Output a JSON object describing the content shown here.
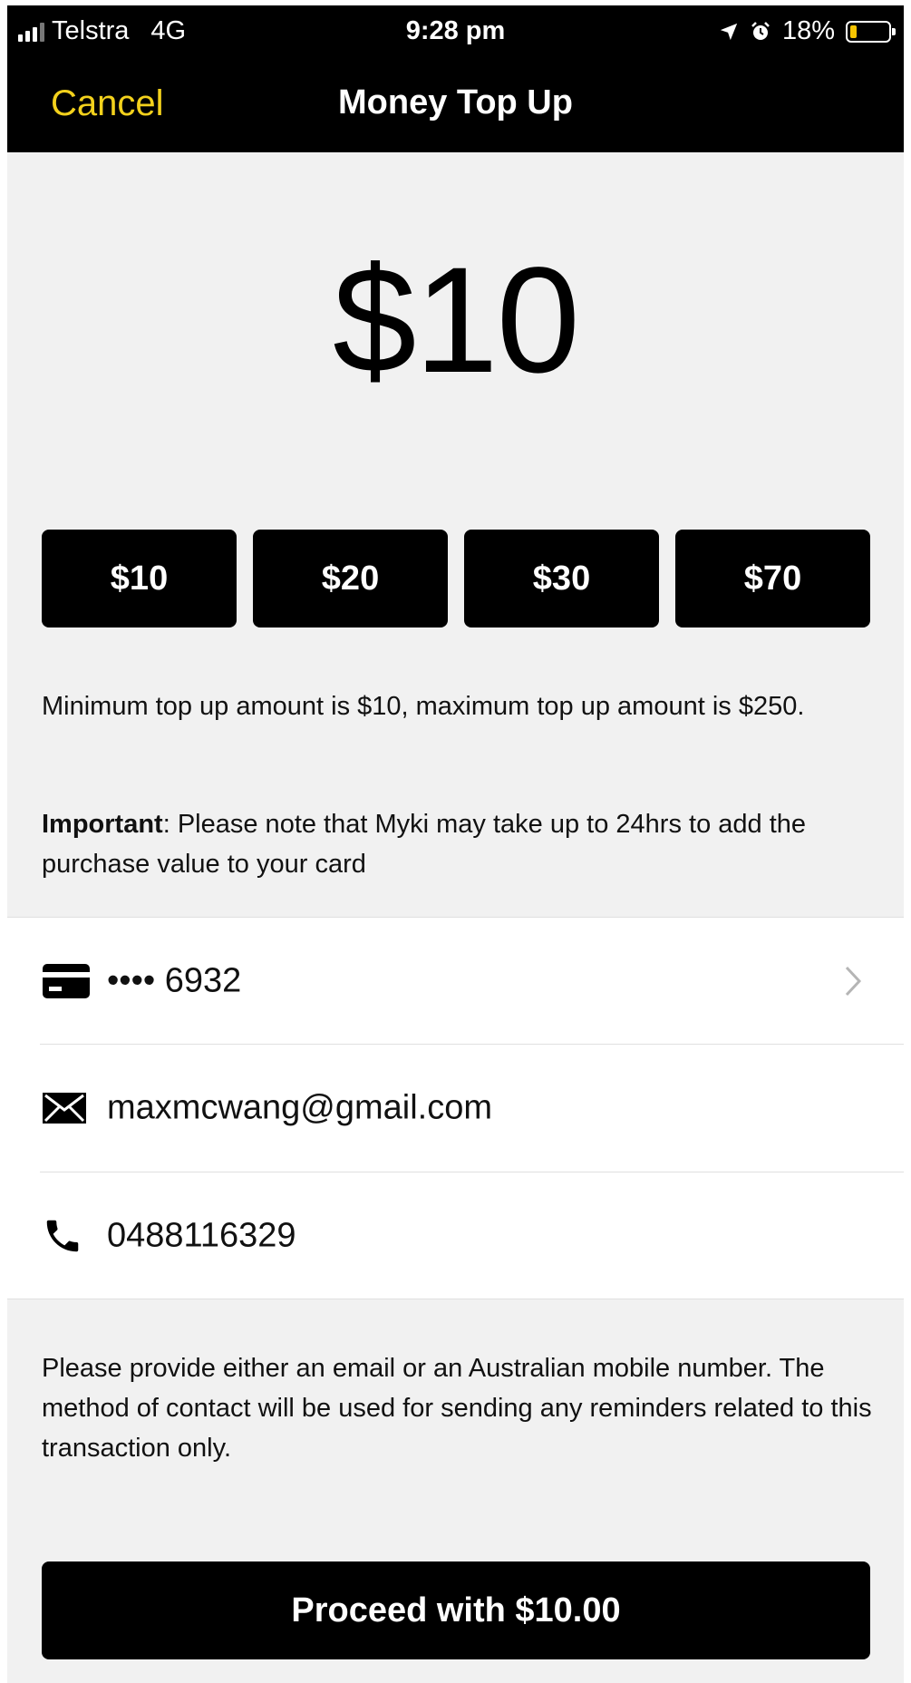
{
  "status_bar": {
    "carrier": "Telstra",
    "network": "4G",
    "time": "9:28 pm",
    "battery": "18%",
    "battery_level": 0.18
  },
  "nav": {
    "cancel_label": "Cancel",
    "title": "Money Top Up"
  },
  "amount": "$10",
  "presets": [
    "$10",
    "$20",
    "$30",
    "$70"
  ],
  "info": {
    "limits": "Minimum top up amount is $10, maximum top up amount is $250.",
    "important_label": "Important",
    "important_text": ": Please note that Myki may take up to 24hrs to add the purchase value to your card"
  },
  "contact": {
    "card_masked": "•••• 6932",
    "email": "maxmcwang@gmail.com",
    "phone": "0488116329"
  },
  "contact_note": "Please provide either an email or an Australian mobile number. The method of contact will be used for sending any reminders related to this transaction only.",
  "proceed_label": "Proceed with $10.00",
  "colors": {
    "accent": "#f3d11c",
    "battery": "#f6c400",
    "background": "#f1f1f1"
  }
}
